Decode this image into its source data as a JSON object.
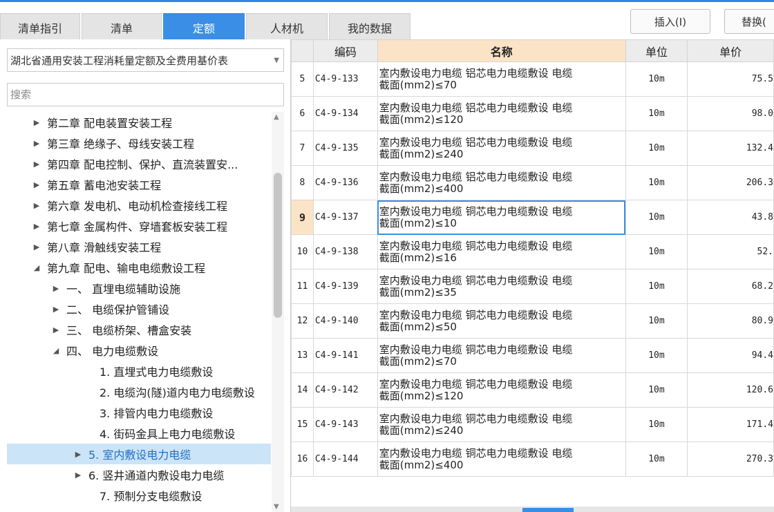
{
  "tabs": [
    {
      "label": "清单指引"
    },
    {
      "label": "清单"
    },
    {
      "label": "定额"
    },
    {
      "label": "人材机"
    },
    {
      "label": "我的数据"
    }
  ],
  "toolbar": {
    "insert_label": "插入(I)",
    "replace_label": "替换("
  },
  "library": {
    "selected": "湖北省通用安装工程消耗量定额及全费用基价表"
  },
  "search": {
    "placeholder": "搜索"
  },
  "tree": [
    {
      "label": "第二章 配电装置安装工程",
      "arrow": "▶"
    },
    {
      "label": "第三章 绝缘子、母线安装工程",
      "arrow": "▶"
    },
    {
      "label": "第四章 配电控制、保护、直流装置安...",
      "arrow": "▶"
    },
    {
      "label": "第五章 蓄电池安装工程",
      "arrow": "▶"
    },
    {
      "label": "第六章 发电机、电动机检查接线工程",
      "arrow": "▶"
    },
    {
      "label": "第七章 金属构件、穿墙套板安装工程",
      "arrow": "▶"
    },
    {
      "label": "第八章 滑触线安装工程",
      "arrow": "▶"
    },
    {
      "label": "第九章 配电、输电电缆敷设工程",
      "arrow": "◢"
    },
    {
      "label": "一、 直埋电缆辅助设施",
      "arrow": "▶"
    },
    {
      "label": "二、 电缆保护管铺设",
      "arrow": "▶"
    },
    {
      "label": "三、 电缆桥架、槽盒安装",
      "arrow": "▶"
    },
    {
      "label": "四、 电力电缆敷设",
      "arrow": "◢"
    },
    {
      "label": "1. 直埋式电力电缆敷设",
      "arrow": ""
    },
    {
      "label": "2. 电缆沟(隧)道内电力电缆敷设",
      "arrow": ""
    },
    {
      "label": "3. 排管内电力电缆敷设",
      "arrow": ""
    },
    {
      "label": "4. 街码金具上电力电缆敷设",
      "arrow": ""
    },
    {
      "label": "5. 室内敷设电力电缆",
      "arrow": "▶"
    },
    {
      "label": "6. 竖井通道内敷设电力电缆",
      "arrow": "▶"
    },
    {
      "label": "7. 预制分支电缆敷设",
      "arrow": ""
    }
  ],
  "table": {
    "headers": {
      "code": "编码",
      "name": "名称",
      "unit": "单位",
      "price": "单价"
    },
    "rows": [
      {
        "idx": "5",
        "code": "C4-9-133",
        "name1": "室内敷设电力电缆 铝芯电力电缆敷设 电缆",
        "name2": "截面(mm2)≤70",
        "unit": "10m",
        "price": "75.5"
      },
      {
        "idx": "6",
        "code": "C4-9-134",
        "name1": "室内敷设电力电缆 铝芯电力电缆敷设 电缆",
        "name2": "截面(mm2)≤120",
        "unit": "10m",
        "price": "98.0"
      },
      {
        "idx": "7",
        "code": "C4-9-135",
        "name1": "室内敷设电力电缆 铝芯电力电缆敷设 电缆",
        "name2": "截面(mm2)≤240",
        "unit": "10m",
        "price": "132.4"
      },
      {
        "idx": "8",
        "code": "C4-9-136",
        "name1": "室内敷设电力电缆 铝芯电力电缆敷设 电缆",
        "name2": "截面(mm2)≤400",
        "unit": "10m",
        "price": "206.3"
      },
      {
        "idx": "9",
        "code": "C4-9-137",
        "name1": "室内敷设电力电缆 铜芯电力电缆敷设 电缆",
        "name2": "截面(mm2)≤10",
        "unit": "10m",
        "price": "43.8"
      },
      {
        "idx": "10",
        "code": "C4-9-138",
        "name1": "室内敷设电力电缆 铜芯电力电缆敷设 电缆",
        "name2": "截面(mm2)≤16",
        "unit": "10m",
        "price": "52."
      },
      {
        "idx": "11",
        "code": "C4-9-139",
        "name1": "室内敷设电力电缆 铜芯电力电缆敷设 电缆",
        "name2": "截面(mm2)≤35",
        "unit": "10m",
        "price": "68.2"
      },
      {
        "idx": "12",
        "code": "C4-9-140",
        "name1": "室内敷设电力电缆 铜芯电力电缆敷设 电缆",
        "name2": "截面(mm2)≤50",
        "unit": "10m",
        "price": "80.9"
      },
      {
        "idx": "13",
        "code": "C4-9-141",
        "name1": "室内敷设电力电缆 铜芯电力电缆敷设 电缆",
        "name2": "截面(mm2)≤70",
        "unit": "10m",
        "price": "94.4"
      },
      {
        "idx": "14",
        "code": "C4-9-142",
        "name1": "室内敷设电力电缆 铜芯电力电缆敷设 电缆",
        "name2": "截面(mm2)≤120",
        "unit": "10m",
        "price": "120.6"
      },
      {
        "idx": "15",
        "code": "C4-9-143",
        "name1": "室内敷设电力电缆 铜芯电力电缆敷设 电缆",
        "name2": "截面(mm2)≤240",
        "unit": "10m",
        "price": "171.4"
      },
      {
        "idx": "16",
        "code": "C4-9-144",
        "name1": "室内敷设电力电缆 铜芯电力电缆敷设 电缆",
        "name2": "截面(mm2)≤400",
        "unit": "10m",
        "price": "270.3"
      }
    ]
  },
  "colors": {
    "accent": "#3a8ee6",
    "header_highlight": "#fbe3c6",
    "selected_row": "#cce4f7"
  }
}
